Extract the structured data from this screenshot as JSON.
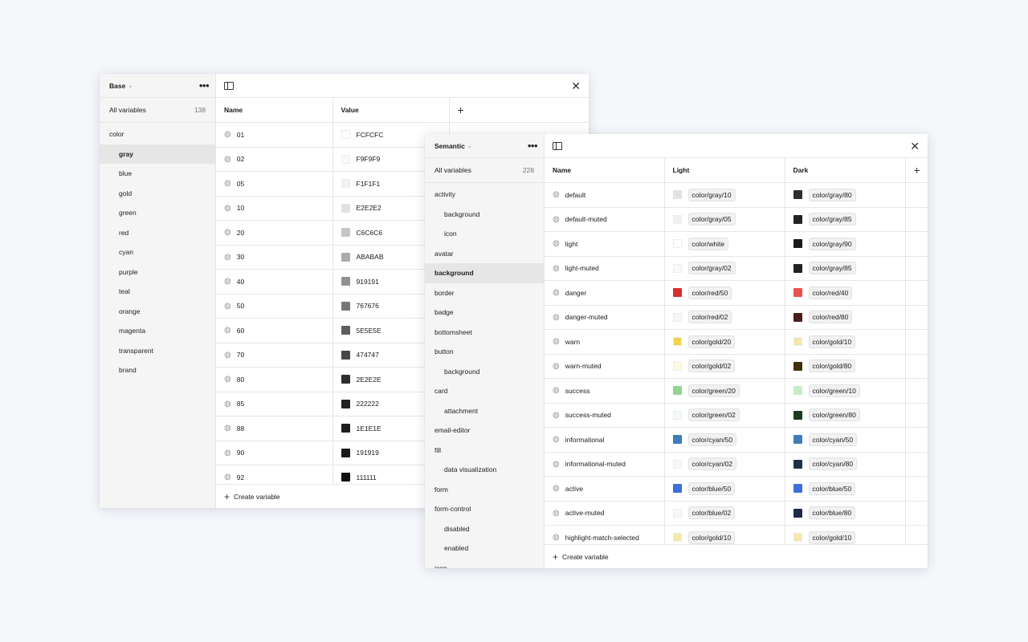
{
  "base": {
    "collection": "Base",
    "all_variables": "All variables",
    "count": "138",
    "groups": [
      {
        "label": "color",
        "sub": false,
        "selected": false
      },
      {
        "label": "gray",
        "sub": true,
        "selected": true
      },
      {
        "label": "blue",
        "sub": true,
        "selected": false
      },
      {
        "label": "gold",
        "sub": true,
        "selected": false
      },
      {
        "label": "green",
        "sub": true,
        "selected": false
      },
      {
        "label": "red",
        "sub": true,
        "selected": false
      },
      {
        "label": "cyan",
        "sub": true,
        "selected": false
      },
      {
        "label": "purple",
        "sub": true,
        "selected": false
      },
      {
        "label": "teal",
        "sub": true,
        "selected": false
      },
      {
        "label": "orange",
        "sub": true,
        "selected": false
      },
      {
        "label": "magenta",
        "sub": true,
        "selected": false
      },
      {
        "label": "transparent",
        "sub": true,
        "selected": false
      },
      {
        "label": "brand",
        "sub": true,
        "selected": false
      }
    ],
    "columns": {
      "name": "Name",
      "value": "Value"
    },
    "rows": [
      {
        "name": "01",
        "value": "FCFCFC",
        "color": "#FCFCFC"
      },
      {
        "name": "02",
        "value": "F9F9F9",
        "color": "#F9F9F9"
      },
      {
        "name": "05",
        "value": "F1F1F1",
        "color": "#F1F1F1"
      },
      {
        "name": "10",
        "value": "E2E2E2",
        "color": "#E2E2E2"
      },
      {
        "name": "20",
        "value": "C6C6C6",
        "color": "#C6C6C6"
      },
      {
        "name": "30",
        "value": "ABABAB",
        "color": "#ABABAB"
      },
      {
        "name": "40",
        "value": "919191",
        "color": "#919191"
      },
      {
        "name": "50",
        "value": "767676",
        "color": "#767676"
      },
      {
        "name": "60",
        "value": "5E5E5E",
        "color": "#5E5E5E"
      },
      {
        "name": "70",
        "value": "474747",
        "color": "#474747"
      },
      {
        "name": "80",
        "value": "2E2E2E",
        "color": "#2E2E2E"
      },
      {
        "name": "85",
        "value": "222222",
        "color": "#222222"
      },
      {
        "name": "88",
        "value": "1E1E1E",
        "color": "#1E1E1E"
      },
      {
        "name": "90",
        "value": "191919",
        "color": "#191919"
      },
      {
        "name": "92",
        "value": "111111",
        "color": "#111111"
      }
    ],
    "create": "Create variable"
  },
  "semantic": {
    "collection": "Semantic",
    "all_variables": "All variables",
    "count": "228",
    "groups": [
      {
        "label": "activity",
        "sub": false,
        "selected": false
      },
      {
        "label": "background",
        "sub": true,
        "selected": false
      },
      {
        "label": "icon",
        "sub": true,
        "selected": false
      },
      {
        "label": "avatar",
        "sub": false,
        "selected": false
      },
      {
        "label": "background",
        "sub": false,
        "selected": true
      },
      {
        "label": "border",
        "sub": false,
        "selected": false
      },
      {
        "label": "badge",
        "sub": false,
        "selected": false
      },
      {
        "label": "bottomsheet",
        "sub": false,
        "selected": false
      },
      {
        "label": "button",
        "sub": false,
        "selected": false
      },
      {
        "label": "background",
        "sub": true,
        "selected": false
      },
      {
        "label": "card",
        "sub": false,
        "selected": false
      },
      {
        "label": "attachment",
        "sub": true,
        "selected": false
      },
      {
        "label": "email-editor",
        "sub": false,
        "selected": false
      },
      {
        "label": "fill",
        "sub": false,
        "selected": false
      },
      {
        "label": "data visualization",
        "sub": true,
        "selected": false
      },
      {
        "label": "form",
        "sub": false,
        "selected": false
      },
      {
        "label": "form-control",
        "sub": false,
        "selected": false
      },
      {
        "label": "disabled",
        "sub": true,
        "selected": false
      },
      {
        "label": "enabled",
        "sub": true,
        "selected": false
      },
      {
        "label": "icon",
        "sub": false,
        "selected": false
      }
    ],
    "columns": {
      "name": "Name",
      "light": "Light",
      "dark": "Dark"
    },
    "rows": [
      {
        "name": "default",
        "light": "color/gray/10",
        "light_color": "#E2E2E2",
        "dark": "color/gray/80",
        "dark_color": "#2E2E2E"
      },
      {
        "name": "default-muted",
        "light": "color/gray/05",
        "light_color": "#F1F1F1",
        "dark": "color/gray/85",
        "dark_color": "#222222"
      },
      {
        "name": "light",
        "light": "color/white",
        "light_color": "#FFFFFF",
        "dark": "color/gray/90",
        "dark_color": "#191919"
      },
      {
        "name": "light-muted",
        "light": "color/gray/02",
        "light_color": "#F9F9F9",
        "dark": "color/gray/85",
        "dark_color": "#222222"
      },
      {
        "name": "danger",
        "light": "color/red/50",
        "light_color": "#D63030",
        "dark": "color/red/40",
        "dark_color": "#E8534E"
      },
      {
        "name": "danger-muted",
        "light": "color/red/02",
        "light_color": "#FBF6F6",
        "dark": "color/red/80",
        "dark_color": "#4A1E1C"
      },
      {
        "name": "warn",
        "light": "color/gold/20",
        "light_color": "#F4D148",
        "dark": "color/gold/10",
        "dark_color": "#F6E7A8"
      },
      {
        "name": "warn-muted",
        "light": "color/gold/02",
        "light_color": "#FDF9DF",
        "dark": "color/gold/80",
        "dark_color": "#3D300A"
      },
      {
        "name": "success",
        "light": "color/green/20",
        "light_color": "#93D393",
        "dark": "color/green/10",
        "dark_color": "#C7EDC5"
      },
      {
        "name": "success-muted",
        "light": "color/green/02",
        "light_color": "#F3FBF2",
        "dark": "color/green/80",
        "dark_color": "#1C3A1C"
      },
      {
        "name": "informational",
        "light": "color/cyan/50",
        "light_color": "#3D7CB8",
        "dark": "color/cyan/50",
        "dark_color": "#3D7CB8"
      },
      {
        "name": "informational-muted",
        "light": "color/cyan/02",
        "light_color": "#F5F8FB",
        "dark": "color/cyan/80",
        "dark_color": "#1C3148"
      },
      {
        "name": "active",
        "light": "color/blue/50",
        "light_color": "#3D6FDD",
        "dark": "color/blue/50",
        "dark_color": "#3D6FDD"
      },
      {
        "name": "active-muted",
        "light": "color/blue/02",
        "light_color": "#F5F7FB",
        "dark": "color/blue/80",
        "dark_color": "#1C2A48"
      },
      {
        "name": "highlight-match-selected",
        "light": "color/gold/10",
        "light_color": "#F6E7A8",
        "dark": "color/gold/10",
        "dark_color": "#F6E7A8"
      }
    ],
    "create": "Create variable"
  },
  "icons": {
    "plus": "+",
    "close": "✕",
    "more": "•••",
    "caret": "⌄",
    "palette": "◍"
  }
}
